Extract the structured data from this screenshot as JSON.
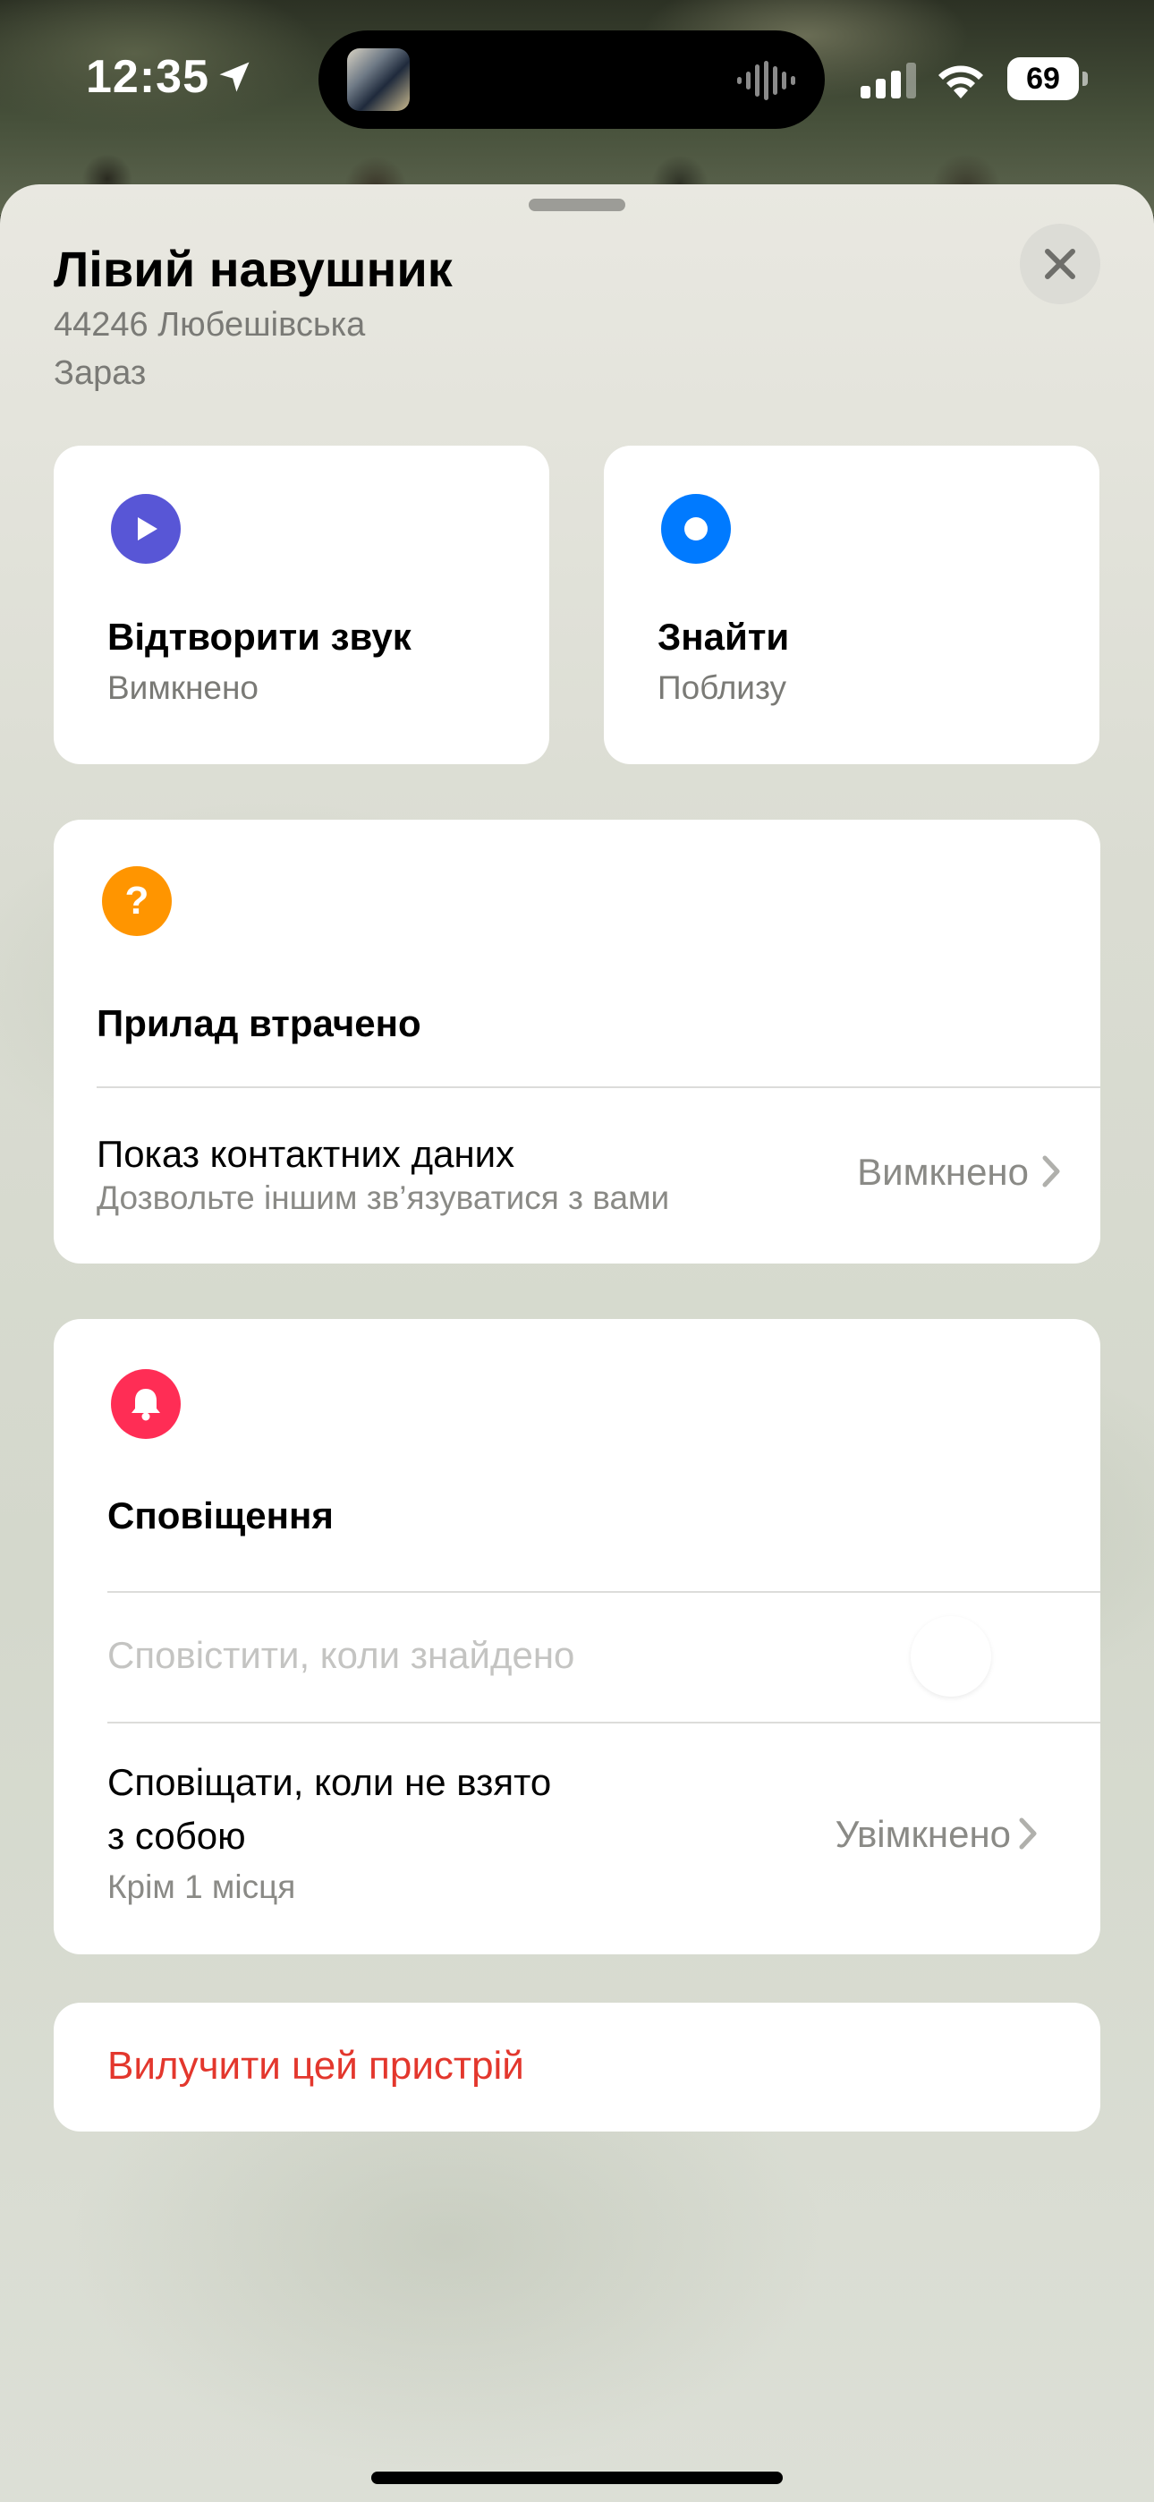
{
  "status_bar": {
    "time": "12:35",
    "battery": "69"
  },
  "sheet": {
    "title": "Лівий навушник",
    "address": "44246 Любешівська",
    "timestamp": "Зараз"
  },
  "actions": {
    "play_sound": {
      "title": "Відтворити звук",
      "subtitle": "Вимкнено",
      "color": "#5856d6"
    },
    "find": {
      "title": "Знайти",
      "subtitle": "Поблизу",
      "color": "#007aff"
    }
  },
  "lost_mode": {
    "title": "Прилад втрачено",
    "icon_color": "#ff9500",
    "contact_row": {
      "label": "Показ контактних даних",
      "sublabel": "Дозвольте іншим зв’язуватися з вами",
      "value": "Вимкнено"
    }
  },
  "notifications": {
    "title": "Сповіщення",
    "icon_color": "#ff2d55",
    "notify_found": {
      "label": "Сповістити, коли знайдено",
      "enabled": false
    },
    "left_behind": {
      "label_line1": "Сповіщати, коли не взято",
      "label_line2": "з собою",
      "sublabel": "Крім 1 місця",
      "value": "Увімкнено"
    }
  },
  "remove": {
    "label": "Вилучити цей пристрій",
    "color": "#e3372d"
  }
}
